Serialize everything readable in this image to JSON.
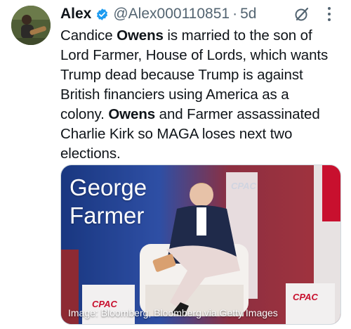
{
  "author": {
    "name": "Alex",
    "handle": "@Alex000110851",
    "separator": "·",
    "time": "5d",
    "verified_color": "#1d9bf0"
  },
  "tweet": {
    "segments": [
      {
        "text": "Candice ",
        "bold": false
      },
      {
        "text": "Owens",
        "bold": true
      },
      {
        "text": " is married to the son of\nLord Farmer, House of Lords, which wants\nTrump dead because  Trump is against\nBritish financiers using America as a\ncolony. ",
        "bold": false
      },
      {
        "text": "Owens",
        "bold": true
      },
      {
        "text": " and Farmer assassinated\nCharlie Kirk so MAGA loses next two\nelections.",
        "bold": false
      }
    ]
  },
  "media": {
    "title": "George\nFarmer",
    "caption": "Image: Bloomberg, Bloomberg via Getty Images",
    "logo_text": "CPAC"
  },
  "icons": {
    "verified": "verified-badge-icon",
    "grok": "grok-icon",
    "more": "more-options-icon"
  },
  "colors": {
    "text": "#0f1419",
    "secondary": "#536471",
    "accent": "#1d9bf0"
  }
}
